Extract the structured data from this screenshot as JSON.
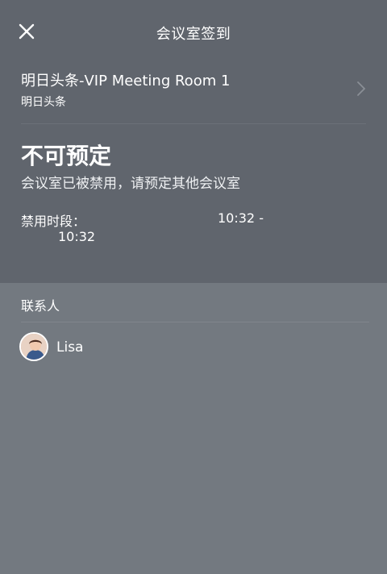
{
  "header": {
    "title": "会议室签到",
    "close_icon": "close-icon"
  },
  "room": {
    "name": "明日头条-VIP Meeting Room 1",
    "org": "明日头条",
    "chevron_icon": "chevron-right-icon"
  },
  "status": {
    "title": "不可预定",
    "description": "会议室已被禁用，请预定其他会议室",
    "period_label": "禁用时段：",
    "period_start": "10:32 -",
    "period_end": "10:32"
  },
  "contacts": {
    "header": "联系人",
    "items": [
      {
        "name": "Lisa",
        "avatar_icon": "user-avatar"
      }
    ]
  },
  "colors": {
    "top_bg": "#60656d",
    "bottom_bg": "#737980",
    "text": "#ffffff"
  }
}
